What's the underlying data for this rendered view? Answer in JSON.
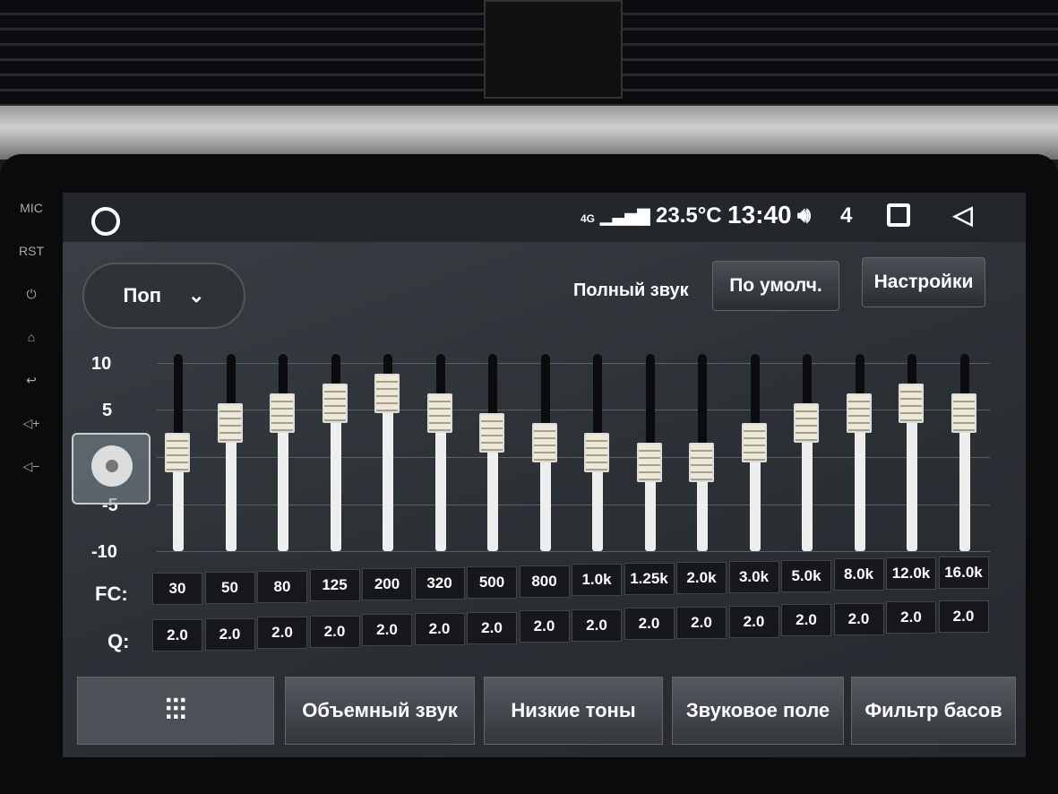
{
  "bezel": {
    "mic": "MIC",
    "rst": "RST",
    "icons": [
      "power-icon",
      "home-icon",
      "back-icon",
      "volume-up-icon",
      "volume-down-icon"
    ]
  },
  "status": {
    "network": "4G",
    "temperature": "23.5°C",
    "time": "13:40",
    "volume": "4"
  },
  "preset": {
    "value": "Поп"
  },
  "header": {
    "full_sound": "Полный звук",
    "default_button": "По умолч.",
    "settings_button": "Настройки"
  },
  "axis": {
    "ticks": [
      "10",
      "5",
      "-5",
      "-10"
    ]
  },
  "eq": {
    "fc_label": "FC:",
    "q_label": "Q:",
    "bands": [
      {
        "fc": "30",
        "q": "2.0",
        "gain": 0
      },
      {
        "fc": "50",
        "q": "2.0",
        "gain": 3
      },
      {
        "fc": "80",
        "q": "2.0",
        "gain": 4
      },
      {
        "fc": "125",
        "q": "2.0",
        "gain": 5
      },
      {
        "fc": "200",
        "q": "2.0",
        "gain": 6
      },
      {
        "fc": "320",
        "q": "2.0",
        "gain": 4
      },
      {
        "fc": "500",
        "q": "2.0",
        "gain": 2
      },
      {
        "fc": "800",
        "q": "2.0",
        "gain": 1
      },
      {
        "fc": "1.0k",
        "q": "2.0",
        "gain": 0
      },
      {
        "fc": "1.25k",
        "q": "2.0",
        "gain": -1
      },
      {
        "fc": "2.0k",
        "q": "2.0",
        "gain": -1
      },
      {
        "fc": "3.0k",
        "q": "2.0",
        "gain": 1
      },
      {
        "fc": "5.0k",
        "q": "2.0",
        "gain": 3
      },
      {
        "fc": "8.0k",
        "q": "2.0",
        "gain": 4
      },
      {
        "fc": "12.0k",
        "q": "2.0",
        "gain": 5
      },
      {
        "fc": "16.0k",
        "q": "2.0",
        "gain": 4
      }
    ]
  },
  "tabs": [
    "Объемный звук",
    "Низкие тоны",
    "Звуковое поле",
    "Фильтр басов"
  ]
}
